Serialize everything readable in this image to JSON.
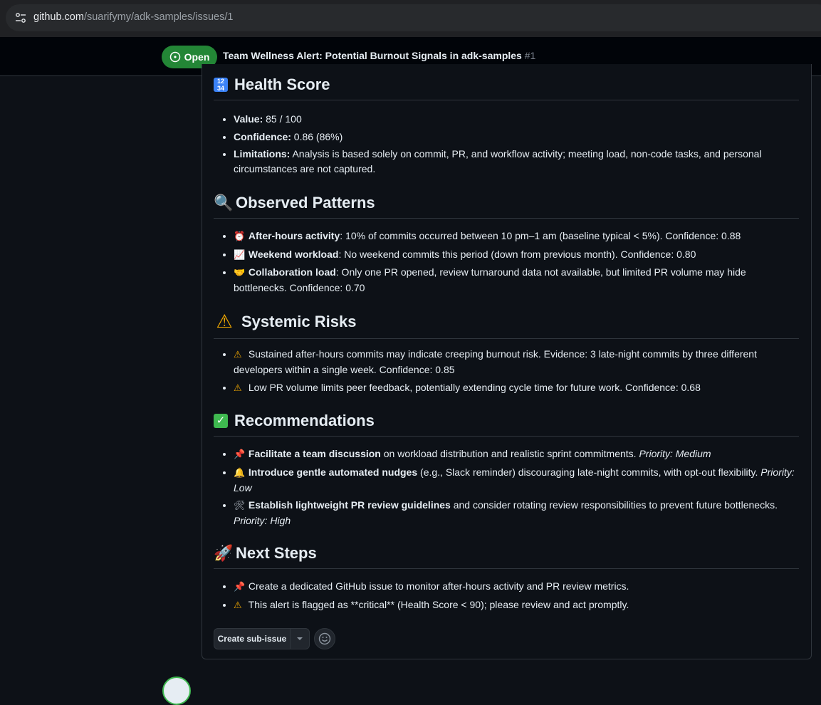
{
  "browser": {
    "url_host": "github.com",
    "url_path": "/suarifymy/adk-samples/issues/1"
  },
  "issue": {
    "state": "Open",
    "title": "Team Wellness Alert: Potential Burnout Signals in adk-samples",
    "number": "#1"
  },
  "sections": {
    "health": {
      "emoji": "1234",
      "title": "Health Score",
      "items": [
        {
          "label": "Value:",
          "text": " 85 / 100"
        },
        {
          "label": "Confidence:",
          "text": " 0.86 (86%)"
        },
        {
          "label": "Limitations:",
          "text": " Analysis is based solely on commit, PR, and workflow activity; meeting load, non-code tasks, and personal circumstances are not captured."
        }
      ]
    },
    "patterns": {
      "emoji": "🔍",
      "title": "Observed Patterns",
      "items": [
        {
          "icon": "⏰",
          "label": "After-hours activity",
          "text": ": 10% of commits occurred between 10 pm–1 am (baseline typical < 5%). Confidence: 0.88"
        },
        {
          "icon": "📈",
          "label": "Weekend workload",
          "text": ": No weekend commits this period (down from previous month). Confidence: 0.80"
        },
        {
          "icon": "🤝",
          "label": "Collaboration load",
          "text": ": Only one PR opened, review turnaround data not available, but limited PR volume may hide bottlenecks. Confidence: 0.70"
        }
      ]
    },
    "risks": {
      "emoji": "⚠",
      "title": "Systemic Risks",
      "items": [
        {
          "icon": "⚠",
          "text": "Sustained after-hours commits may indicate creeping burnout risk. Evidence: 3 late-night commits by three different developers within a single week. Confidence: 0.85"
        },
        {
          "icon": "⚠",
          "text": "Low PR volume limits peer feedback, potentially extending cycle time for future work. Confidence: 0.68"
        }
      ]
    },
    "recs": {
      "emoji": "✓",
      "title": "Recommendations",
      "items": [
        {
          "icon": "📌",
          "label": "Facilitate a team discussion",
          "text": " on workload distribution and realistic sprint commitments. ",
          "priority": "Priority: Medium"
        },
        {
          "icon": "🔔",
          "label": "Introduce gentle automated nudges",
          "text": " (e.g., Slack reminder) discouraging late-night commits, with opt-out flexibility. ",
          "priority": "Priority: Low"
        },
        {
          "icon": "🛠",
          "label": "Establish lightweight PR review guidelines",
          "text": " and consider rotating review responsibilities to prevent future bottlenecks. ",
          "priority": "Priority: High"
        }
      ]
    },
    "next": {
      "emoji": "🚀",
      "title": "Next Steps",
      "items": [
        {
          "icon": "📌",
          "text": "Create a dedicated GitHub issue to monitor after-hours activity and PR review metrics."
        },
        {
          "icon": "⚠",
          "text": "This alert is flagged as **critical** (Health Score < 90); please review and act promptly."
        }
      ]
    }
  },
  "actions": {
    "create_sub_issue": "Create sub-issue",
    "dropdown_icon": "triangle-down-icon",
    "reaction_icon": "smiley-icon"
  },
  "colors": {
    "open_green": "#238636",
    "background": "#0d1117",
    "border": "#30363d"
  }
}
